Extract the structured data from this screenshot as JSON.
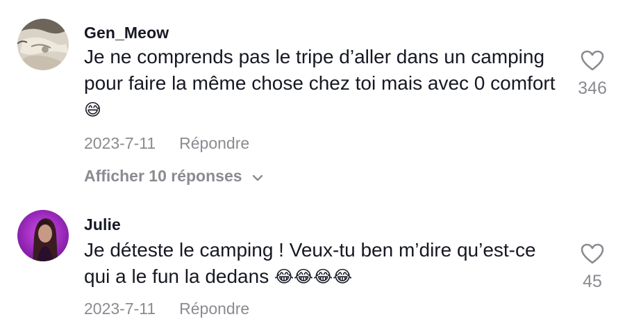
{
  "comments": [
    {
      "username": "Gen_Meow",
      "text": "Je ne comprends pas le tripe d’aller dans un camping pour faire la même chose chez toi mais avec 0 comfort",
      "emoji": "😅",
      "date": "2023-7-11",
      "reply_label": "Répondre",
      "likes": "346",
      "view_replies": "Afficher 10 réponses"
    },
    {
      "username": "Julie",
      "text": "Je déteste le camping ! Veux-tu ben m’dire qu’est-ce qui a le fun la dedans",
      "emoji": "😂😂😂😂",
      "date": "2023-7-11",
      "reply_label": "Répondre",
      "likes": "45"
    }
  ],
  "colors": {
    "primary_text": "#161823",
    "secondary_text": "#8a8b91"
  },
  "icons": {
    "like": "heart-outline-icon",
    "expand": "chevron-down-icon"
  }
}
